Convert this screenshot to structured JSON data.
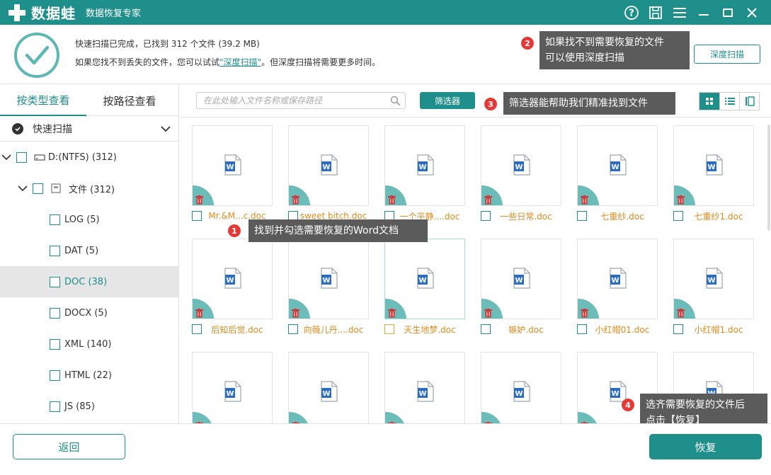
{
  "app": {
    "logo_name": "数据蛙",
    "subtitle": "数据恢复专家",
    "brand_color": "#1f8f8c"
  },
  "titlebar": {
    "icons": [
      "help-icon",
      "save-icon",
      "menu-icon",
      "minimize-icon",
      "maximize-icon",
      "close-icon"
    ]
  },
  "header": {
    "status_line": "快速扫描已完成，已找到 312 个文件 (39.2 MB)",
    "hint_prefix": "如果您找不到丢失的文件，您可以试试",
    "hint_link": "\"深度扫描\"",
    "hint_suffix": "。但深度扫描将需要更多时间。",
    "deep_scan_button": "深度扫描"
  },
  "tips": [
    {
      "num": "1",
      "text": "找到并勾选需要恢复的Word文档"
    },
    {
      "num": "2",
      "text_line1": "如果找不到需要恢复的文件",
      "text_line2": "可以使用深度扫描"
    },
    {
      "num": "3",
      "text": "筛选器能帮助我们精准找到文件"
    },
    {
      "num": "4",
      "text_line1": "选齐需要恢复的文件后",
      "text_line2": "点击【恢复】"
    }
  ],
  "sidebar": {
    "tabs": [
      "按类型查看",
      "按路径查看"
    ],
    "active_tab": 0,
    "quick_scan_label": "快速扫描",
    "tree": [
      {
        "label": "D:(NTFS) (312)",
        "level": 0,
        "expanded": true,
        "icon": "drive-icon"
      },
      {
        "label": "文件 (312)",
        "level": 1,
        "expanded": true,
        "icon": "folder-icon"
      },
      {
        "label": "LOG (5)",
        "level": 2
      },
      {
        "label": "DAT (5)",
        "level": 2
      },
      {
        "label": "DOC (38)",
        "level": 2,
        "selected": true
      },
      {
        "label": "DOCX (5)",
        "level": 2
      },
      {
        "label": "XML (140)",
        "level": 2
      },
      {
        "label": "HTML (22)",
        "level": 2
      },
      {
        "label": "JS (85)",
        "level": 2
      }
    ]
  },
  "toolbar": {
    "search_placeholder": "在此处输入文件名称或保存路径",
    "filter_button": "筛选器",
    "views": [
      "grid-view-icon",
      "list-view-icon",
      "detail-view-icon"
    ],
    "active_view": 0
  },
  "files": [
    "Mr.&M...c.doc",
    "sweet bitch.doc",
    "一个平静....doc",
    "一些日常.doc",
    "七重纱.doc",
    "七重纱1.doc",
    "后知后觉.doc",
    "向薇儿丹....doc",
    "天生地梦.doc",
    "嫉妒.doc",
    "小红帽01.doc",
    "小红帽1.doc",
    "",
    "",
    "",
    "",
    "",
    ""
  ],
  "footer": {
    "back_button": "返回",
    "recover_button": "恢复"
  }
}
